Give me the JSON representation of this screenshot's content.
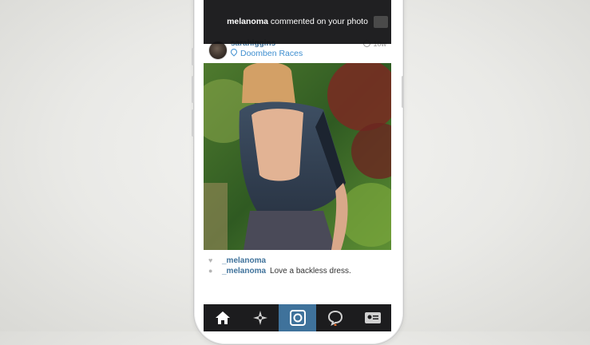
{
  "notification": {
    "user": "melanoma",
    "message": "commented on your photo"
  },
  "post": {
    "username": "sarahiggins",
    "location": "Doomben Races",
    "timestamp": "10w"
  },
  "likes": {
    "user": "_melanoma"
  },
  "comment": {
    "user": "_melanoma",
    "text": "Love a backless dress."
  },
  "tabs": [
    {
      "name": "home-icon"
    },
    {
      "name": "explore-icon"
    },
    {
      "name": "camera-icon"
    },
    {
      "name": "activity-icon"
    },
    {
      "name": "profile-icon"
    }
  ],
  "colors": {
    "accent": "#3f729b",
    "link": "#3f8fd0",
    "tabbar": "#1c1c1e"
  }
}
